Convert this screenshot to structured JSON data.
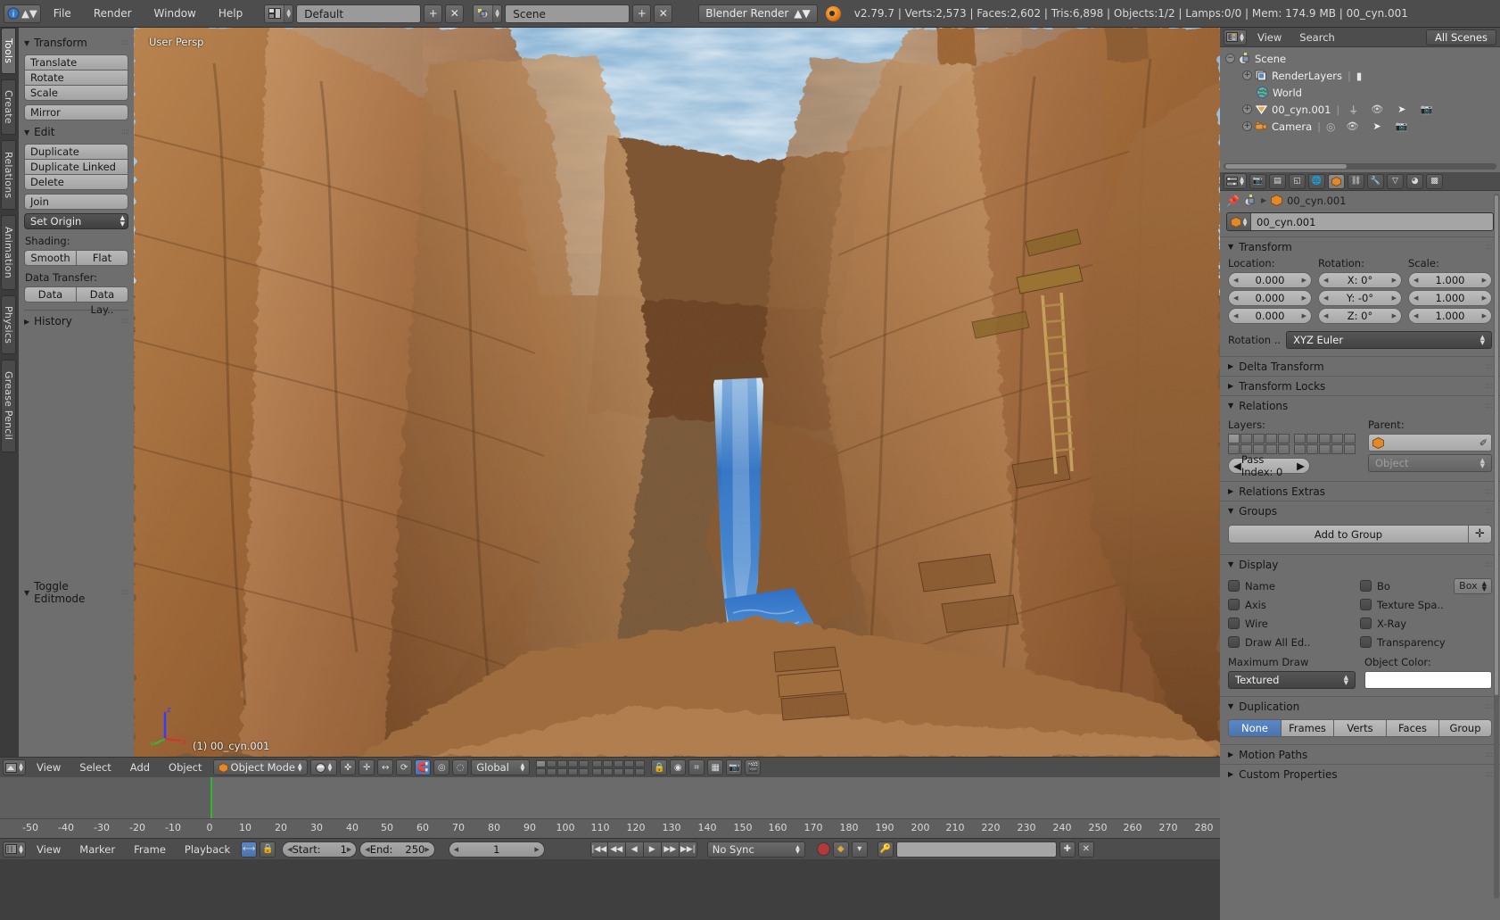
{
  "topbar": {
    "menus": [
      "File",
      "Render",
      "Window",
      "Help"
    ],
    "screen_layout": "Default",
    "scene_name": "Scene",
    "engine": "Blender Render",
    "status": "v2.79.7 | Verts:2,573 | Faces:2,602 | Tris:6,898 | Objects:1/2 | Lamps:0/0 | Mem: 174.9 MB | 00_cyn.001",
    "add_label": "+",
    "remove_label": "✕"
  },
  "rail": {
    "tabs": [
      "Tools",
      "Create",
      "Relations",
      "Animation",
      "Physics",
      "Grease Pencil"
    ],
    "selected": "Tools"
  },
  "toolshelf": {
    "transform": {
      "title": "Transform",
      "buttons": [
        "Translate",
        "Rotate",
        "Scale",
        "Mirror"
      ]
    },
    "edit": {
      "title": "Edit",
      "buttons": [
        "Duplicate",
        "Duplicate Linked",
        "Delete",
        "Join"
      ],
      "set_origin": "Set Origin",
      "shading_label": "Shading:",
      "shading": [
        "Smooth",
        "Flat"
      ],
      "data_transfer_label": "Data Transfer:",
      "data_transfer": [
        "Data",
        "Data Lay.."
      ]
    },
    "history": {
      "title": "History"
    },
    "toggle_editmode": {
      "title": "Toggle Editmode"
    }
  },
  "viewport": {
    "persp_label": "User Persp",
    "object_label": "(1) 00_cyn.001",
    "gizmo_axes": [
      "z",
      "y",
      "x"
    ],
    "gizmo_colors": {
      "z": "#3a3aff",
      "y": "#2fbe2f",
      "x": "#d63030"
    }
  },
  "viewport_header": {
    "menus": [
      "View",
      "Select",
      "Add",
      "Object"
    ],
    "mode": "Object Mode",
    "transform_orientation": "Global",
    "icons": [
      "editor-type-icon",
      "viewport-shading-icon",
      "pivot-icon",
      "snap-magnet-icon",
      "proportional-edit-icon",
      "manipulator-icon",
      "render-preview-icon",
      "object-type-filter-icon"
    ]
  },
  "timeline": {
    "menus": [
      "View",
      "Marker",
      "Frame",
      "Playback"
    ],
    "start_label": "Start:",
    "start_value": "1",
    "end_label": "End:",
    "end_value": "250",
    "current_frame": "1",
    "sync_mode": "No Sync",
    "playhead_frame": 1,
    "ruler_ticks": [
      "-50",
      "-40",
      "-30",
      "-20",
      "-10",
      "0",
      "10",
      "20",
      "30",
      "40",
      "50",
      "60",
      "70",
      "80",
      "90",
      "100",
      "110",
      "120",
      "130",
      "140",
      "150",
      "160",
      "170",
      "180",
      "190",
      "200",
      "210",
      "220",
      "230",
      "240",
      "250",
      "260",
      "270",
      "280"
    ]
  },
  "outliner": {
    "header": {
      "view": "View",
      "search": "Search",
      "display_mode": "All Scenes"
    },
    "rows": [
      {
        "label": "Scene",
        "icon": "scene-icon",
        "indent": 0,
        "expanded": true,
        "toggle": "−"
      },
      {
        "label": "RenderLayers",
        "icon": "renderlayers-icon",
        "indent": 1,
        "expanded": false,
        "toggle": "+"
      },
      {
        "label": "World",
        "icon": "world-icon",
        "indent": 1,
        "expanded": null,
        "toggle": ""
      },
      {
        "label": "00_cyn.001",
        "icon": "mesh-object-icon",
        "indent": 1,
        "expanded": false,
        "toggle": "+"
      },
      {
        "label": "Camera",
        "icon": "camera-icon",
        "indent": 1,
        "expanded": false,
        "toggle": "+"
      }
    ]
  },
  "properties": {
    "breadcrumb_object": "00_cyn.001",
    "object_name": "00_cyn.001",
    "tabs": [
      "render-tab",
      "render-layers-tab",
      "scene-tab",
      "world-tab",
      "object-tab",
      "constraints-tab",
      "modifiers-tab",
      "data-tab",
      "material-tab",
      "texture-tab"
    ],
    "active_tab_index": 4,
    "transform": {
      "title": "Transform",
      "location_label": "Location:",
      "rotation_label": "Rotation:",
      "scale_label": "Scale:",
      "location": [
        "0.000",
        "0.000",
        "0.000"
      ],
      "rotation": [
        "X:  0°",
        "Y: -0°",
        "Z:  0°"
      ],
      "scale": [
        "1.000",
        "1.000",
        "1.000"
      ],
      "rotation_mode_label": "Rotation ..",
      "rotation_mode": "XYZ Euler"
    },
    "delta_transform": {
      "title": "Delta Transform"
    },
    "transform_locks": {
      "title": "Transform Locks"
    },
    "relations": {
      "title": "Relations",
      "layers_label": "Layers:",
      "parent_label": "Parent:",
      "parent_value": "",
      "parent_type": "Object",
      "pass_index": "Pass Index: 0"
    },
    "relations_extras": {
      "title": "Relations Extras"
    },
    "groups": {
      "title": "Groups",
      "add_to_group": "Add to Group",
      "plus": "✛"
    },
    "display": {
      "title": "Display",
      "left_checks": [
        "Name",
        "Axis",
        "Wire",
        "Draw All Ed.."
      ],
      "right_checks": [
        "Bo",
        "Texture Spa..",
        "X-Ray",
        "Transparency"
      ],
      "bounds_value": "Box",
      "maximum_draw_label": "Maximum Draw",
      "maximum_draw_value": "Textured",
      "object_color_label": "Object Color:",
      "object_color": "#ffffff"
    },
    "duplication": {
      "title": "Duplication",
      "options": [
        "None",
        "Frames",
        "Verts",
        "Faces",
        "Group"
      ],
      "selected": "None",
      "accent": "#4a74ae"
    },
    "motion_paths": {
      "title": "Motion Paths"
    },
    "custom_properties": {
      "title": "Custom Properties"
    }
  }
}
